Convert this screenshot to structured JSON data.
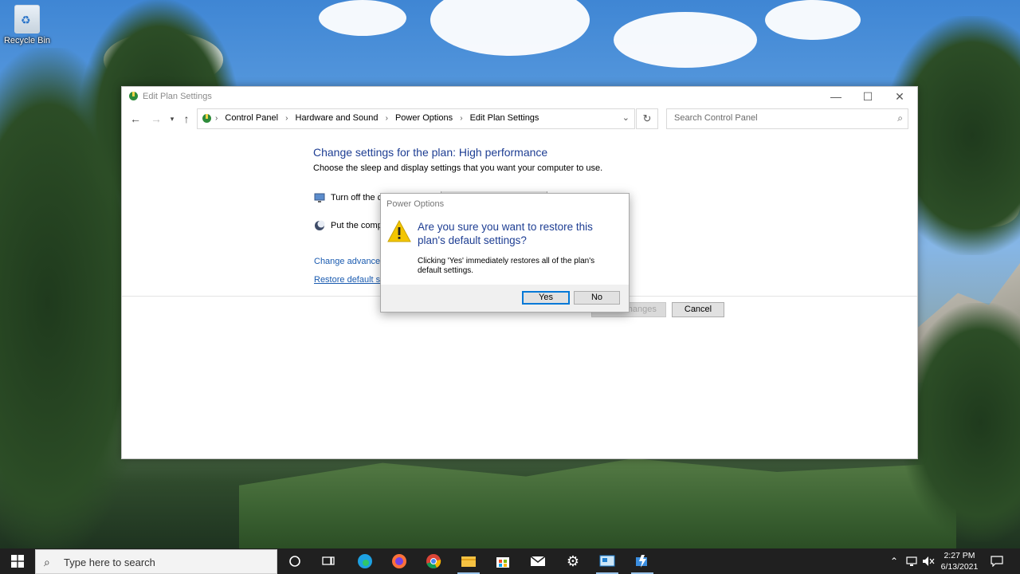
{
  "desktop": {
    "icons": [
      {
        "label": "Recycle Bin",
        "icon": "recycle-bin-icon"
      }
    ]
  },
  "window": {
    "title": "Edit Plan Settings",
    "controls": {
      "minimize": "—",
      "maximize": "☐",
      "close": "✕"
    },
    "address": {
      "breadcrumbs": [
        "Control Panel",
        "Hardware and Sound",
        "Power Options",
        "Edit Plan Settings"
      ]
    },
    "search_placeholder": "Search Control Panel",
    "content": {
      "heading": "Change settings for the plan: High performance",
      "subtext": "Choose the sleep and display settings that you want your computer to use.",
      "settings": [
        {
          "label": "Turn off the d",
          "icon": "monitor-icon"
        },
        {
          "label": "Put the comp",
          "icon": "moon-icon"
        }
      ],
      "links": {
        "advanced": "Change advanced",
        "restore": "Restore default se"
      },
      "buttons": {
        "save": "Save changes",
        "cancel": "Cancel"
      }
    }
  },
  "dialog": {
    "title": "Power Options",
    "question": "Are you sure you want to restore this plan's default settings?",
    "detail": "Clicking 'Yes' immediately restores all of the plan's default settings.",
    "buttons": {
      "yes": "Yes",
      "no": "No"
    }
  },
  "taskbar": {
    "search_placeholder": "Type here to search",
    "apps": [
      "cortana-icon",
      "task-view-icon",
      "edge-icon",
      "firefox-icon",
      "chrome-icon",
      "file-explorer-icon",
      "store-icon",
      "mail-icon",
      "settings-icon",
      "control-panel-icon",
      "power-options-icon"
    ],
    "clock": {
      "time": "2:27 PM",
      "date": "6/13/2021"
    }
  },
  "colors": {
    "heading_blue": "#1e3e93",
    "link_blue": "#1a5bb0",
    "taskbar": "#202020",
    "focus_accent": "#0078d7",
    "warning_yellow": "#f3c500"
  }
}
